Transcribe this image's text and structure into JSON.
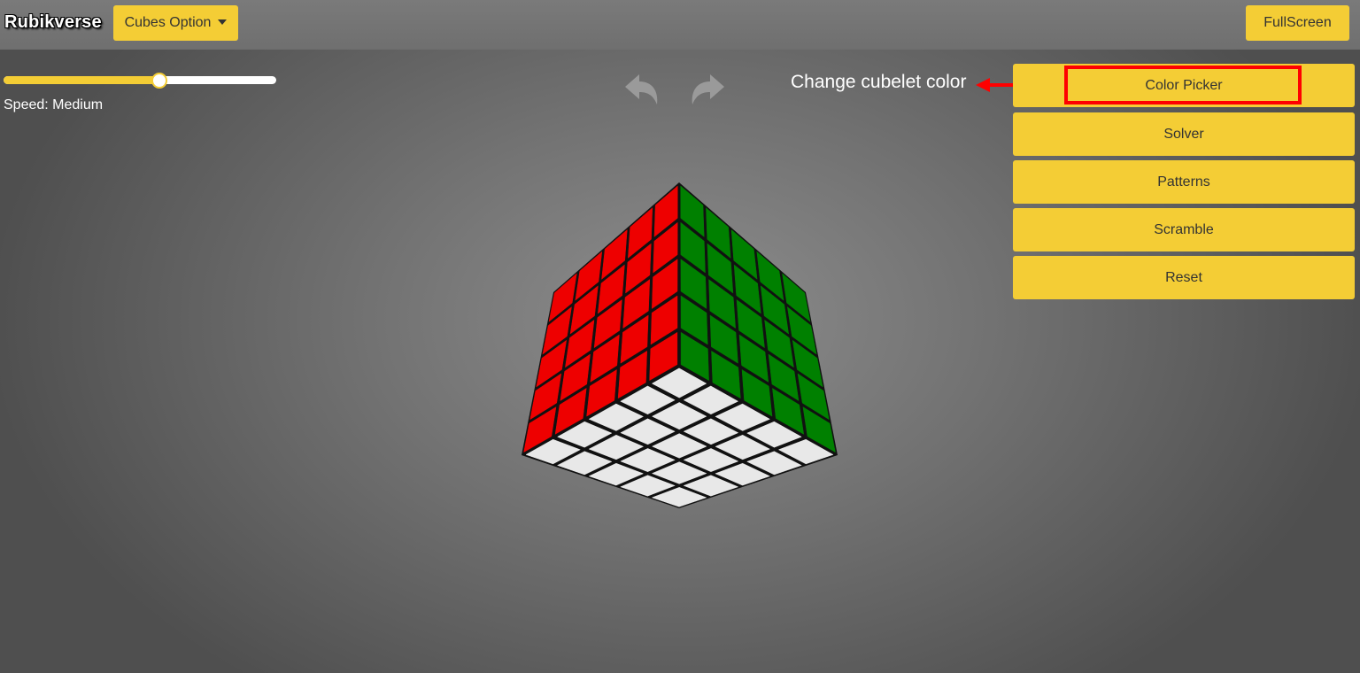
{
  "header": {
    "brand": "Rubikverse",
    "cubes_option_label": "Cubes Option",
    "fullscreen_label": "FullScreen"
  },
  "speed": {
    "label": "Speed: Medium",
    "value_fraction": 0.57
  },
  "history": {
    "undo_icon": "undo-arrow-icon",
    "redo_icon": "redo-arrow-icon"
  },
  "annotation": {
    "text": "Change cubelet color"
  },
  "sidebar": {
    "buttons": [
      {
        "label": "Color Picker"
      },
      {
        "label": "Solver"
      },
      {
        "label": "Patterns"
      },
      {
        "label": "Scramble"
      },
      {
        "label": "Reset"
      }
    ]
  },
  "cube": {
    "size": 5,
    "faces": {
      "left": "#ee0000",
      "right": "#008000",
      "bottom": "#e8e8e8"
    }
  },
  "colors": {
    "accent": "#f4cd35",
    "highlight": "#ff0000"
  }
}
